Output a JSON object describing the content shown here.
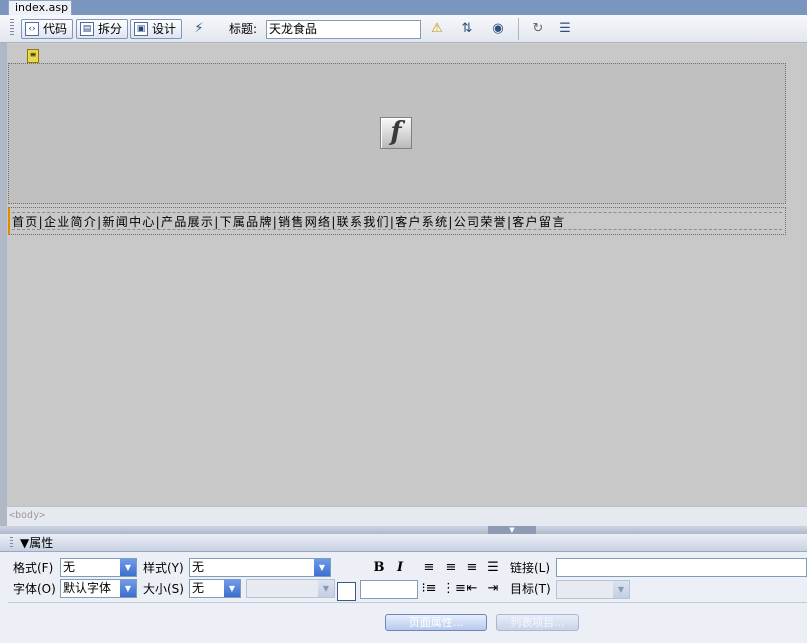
{
  "tab": {
    "label": "index.asp"
  },
  "toolbar": {
    "code_label": "代码",
    "split_label": "拆分",
    "design_label": "设计",
    "title_label": "标题:",
    "title_value": "天龙食品"
  },
  "canvas": {
    "nav_text": "首页|企业简介|新闻中心|产品展示|下属品牌|销售网络|联系我们|客户系统|公司荣誉|客户留言"
  },
  "tag_selector": {
    "body_tag": "<body>"
  },
  "properties": {
    "title": "▼属性",
    "format_label": "格式(F)",
    "format_value": "无",
    "style_label": "样式(Y)",
    "style_value": "无",
    "link_label": "链接(L)",
    "font_label": "字体(O)",
    "font_value": "默认字体",
    "size_label": "大小(S)",
    "size_value": "无",
    "target_label": "目标(T)",
    "page_props_button": "页面属性...",
    "list_item_button": "列表项目..."
  }
}
